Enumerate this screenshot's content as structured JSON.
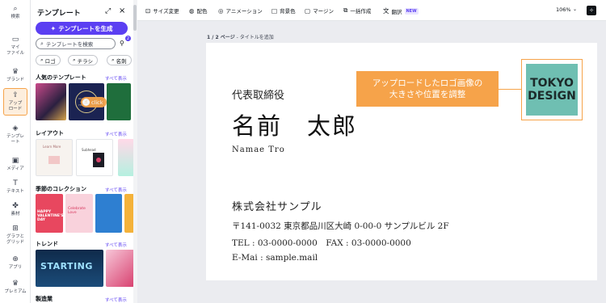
{
  "rail": {
    "items": [
      {
        "icon": "search-icon",
        "glyph": "⌕",
        "label": "検索"
      },
      {
        "icon": "folder-icon",
        "glyph": "▭",
        "label": "マイ\nファイル"
      },
      {
        "icon": "brand-icon",
        "glyph": "♛",
        "label": "ブランド"
      },
      {
        "icon": "upload-icon",
        "glyph": "⇪",
        "label": "アップ\nロード"
      },
      {
        "icon": "template-icon",
        "glyph": "◈",
        "label": "テンプレ\nート"
      },
      {
        "icon": "media-icon",
        "glyph": "▣",
        "label": "メディア"
      },
      {
        "icon": "text-icon",
        "glyph": "T",
        "label": "テキスト"
      },
      {
        "icon": "elements-icon",
        "glyph": "✤",
        "label": "素材"
      },
      {
        "icon": "graphs-grid-icon",
        "glyph": "⊞",
        "label": "グラフと\nグリッド"
      },
      {
        "icon": "apps-icon",
        "glyph": "⊕",
        "label": "アプリ"
      },
      {
        "icon": "premium-icon",
        "glyph": "♛",
        "label": "プレミアム"
      }
    ]
  },
  "panel": {
    "title": "テンプレート",
    "generate_label": "テンプレートを生成",
    "search_placeholder": "テンプレートを検索",
    "filter_count": "2",
    "chips": [
      "ロゴ",
      "チラシ",
      "名刺"
    ],
    "sections": [
      {
        "title": "人気のテンプレート",
        "see_all": "すべて表示"
      },
      {
        "title": "レイアウト",
        "see_all": "すべて表示"
      },
      {
        "title": "季節のコレクション",
        "see_all": "すべて表示"
      },
      {
        "title": "トレンド",
        "see_all": "すべて表示"
      },
      {
        "title": "製造業",
        "see_all": "すべて表示"
      }
    ],
    "thumbs": {
      "horoscope": "ALL SIGNS AT A GLANCE HOROSCOPE",
      "learn_more": "Learn More",
      "subhead": "Subhead",
      "valentine": "HAPPY VALENTINE'S DAY",
      "celebrate": "Celebrate Love",
      "starting": "STARTING"
    },
    "click_label": "click"
  },
  "toolbar": {
    "items": [
      {
        "icon": "resize-icon",
        "glyph": "⊡",
        "label": "サイズ変更"
      },
      {
        "icon": "palette-icon",
        "glyph": "◍",
        "label": "配色"
      },
      {
        "icon": "animation-icon",
        "glyph": "◎",
        "label": "アニメーション"
      },
      {
        "icon": "background-color-icon",
        "glyph": "□",
        "label": "背景色"
      },
      {
        "icon": "margin-icon",
        "glyph": "▢",
        "label": "マージン"
      },
      {
        "icon": "bulk-create-icon",
        "glyph": "⧉",
        "label": "一括作成"
      },
      {
        "icon": "translate-icon",
        "glyph": "文",
        "label": "翻訳",
        "badge": "NEW"
      }
    ],
    "zoom": "106%"
  },
  "canvas": {
    "page_label": "1 / 2 ページ",
    "page_title_placeholder": "タイトルを追加",
    "card": {
      "title": "代表取締役",
      "name": "名前　太郎",
      "name_romaji": "Namae Tro",
      "company": "株式会社サンプル",
      "address": "〒141-0032 東京都品川区大崎 0-00-0 サンプルビル 2F",
      "phone_fax": "TEL : 03-0000-0000　FAX : 03-0000-0000",
      "email": "E-Mai : sample.mail"
    },
    "callout_lines": [
      "アップロードしたロゴ画像の",
      "大きさや位置を調整"
    ],
    "logo_lines": [
      "TOKYO",
      "DESIGN"
    ]
  },
  "colors": {
    "accent": "#5b3ff2",
    "highlight": "#f6a34a",
    "logo_bg": "#6fbfb2"
  }
}
